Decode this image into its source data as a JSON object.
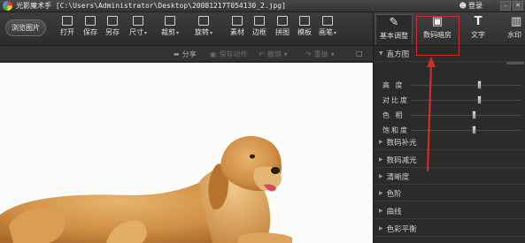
{
  "window": {
    "app_name": "光影魔术手",
    "file_path": "[C:\\Users\\Administrator\\Desktop\\20081217T054130_2.jpg]",
    "login_label": "登录"
  },
  "toolbar": {
    "browse_label": "浏览图片",
    "tools": [
      {
        "label": "打开",
        "icon": "open-icon",
        "dropdown": false
      },
      {
        "label": "保存",
        "icon": "save-icon",
        "dropdown": false
      },
      {
        "label": "另存",
        "icon": "save-as-icon",
        "dropdown": false
      },
      {
        "label": "尺寸",
        "icon": "resize-icon",
        "dropdown": true
      },
      {
        "label": "裁剪",
        "icon": "crop-icon",
        "dropdown": true
      },
      {
        "label": "旋转",
        "icon": "rotate-icon",
        "dropdown": true
      },
      {
        "label": "素材",
        "icon": "material-icon",
        "dropdown": false
      },
      {
        "label": "边框",
        "icon": "border-icon",
        "dropdown": false
      },
      {
        "label": "拼图",
        "icon": "collage-icon",
        "dropdown": false
      },
      {
        "label": "模板",
        "icon": "template-icon",
        "dropdown": false
      },
      {
        "label": "画笔",
        "icon": "brush-icon",
        "dropdown": true
      }
    ]
  },
  "subbar": {
    "share": "分享",
    "save_action": "保存动作",
    "undo": "撤销",
    "redo": "重做"
  },
  "panel": {
    "tabs": [
      {
        "label": "基本调整",
        "icon": "basic-adjust-icon",
        "active": true
      },
      {
        "label": "数码暗房",
        "icon": "camera-icon",
        "active": false
      },
      {
        "label": "文字",
        "icon": "text-icon",
        "active": false
      },
      {
        "label": "水印",
        "icon": "watermark-icon",
        "active": false
      }
    ],
    "histogram": "直方图",
    "sliders": [
      {
        "label": "高 度",
        "value": 0.63
      },
      {
        "label": "对比度",
        "value": 0.63
      },
      {
        "label": "色 相",
        "value": 0.58
      },
      {
        "label": "饱和度",
        "value": 0.58
      }
    ],
    "sections": [
      "数码补光",
      "数码减光",
      "清晰度",
      "色阶",
      "曲线",
      "色彩平衡"
    ]
  },
  "colors": {
    "annotation": "#d52b2b"
  }
}
